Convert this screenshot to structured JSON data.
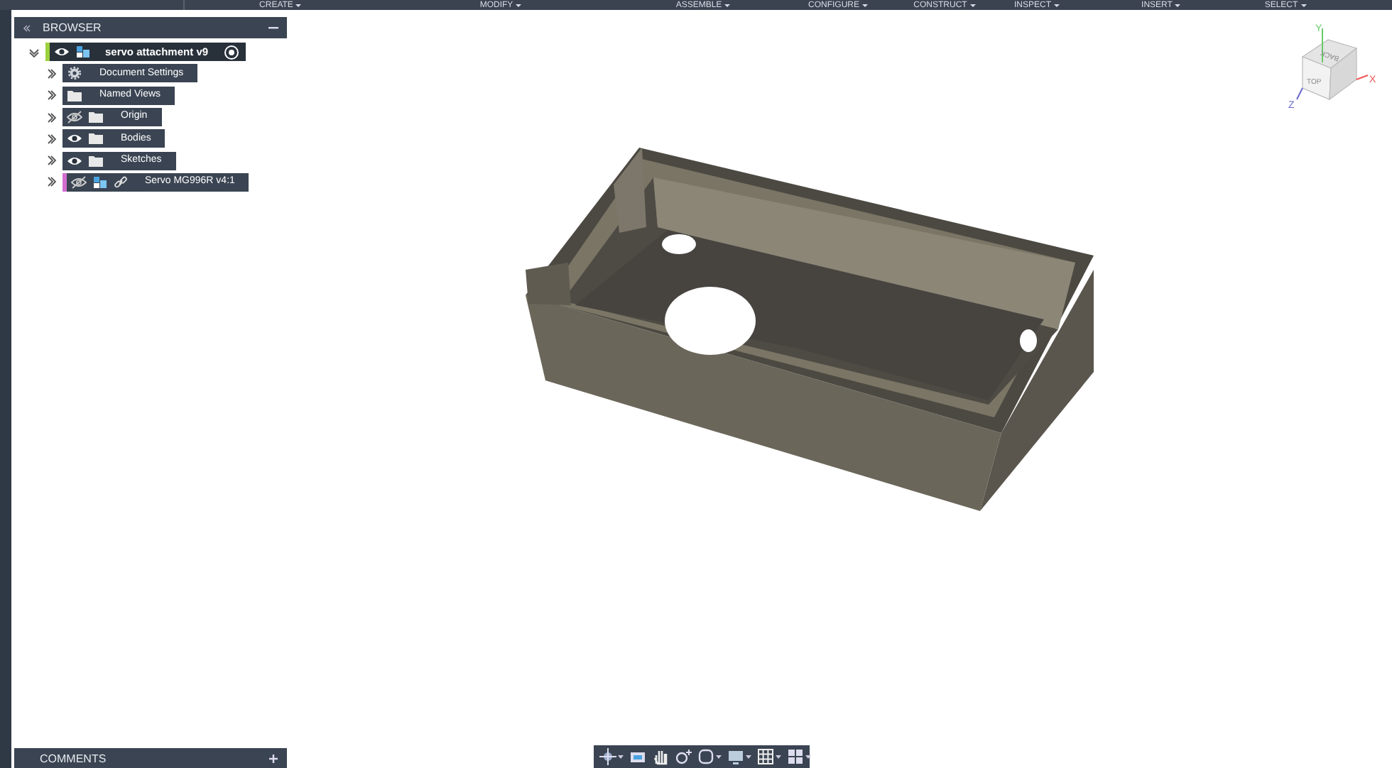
{
  "toolbar": {
    "menus": [
      {
        "label": "CREATE"
      },
      {
        "label": "MODIFY"
      },
      {
        "label": "ASSEMBLE"
      },
      {
        "label": "CONFIGURE"
      },
      {
        "label": "CONSTRUCT"
      },
      {
        "label": "INSPECT"
      },
      {
        "label": "INSERT"
      },
      {
        "label": "SELECT"
      }
    ]
  },
  "browser": {
    "title": "BROWSER",
    "root": {
      "label": "servo attachment v9",
      "expanded": true,
      "visible": true,
      "active": true,
      "color": "#9ad13c",
      "children": [
        {
          "label": "Document Settings",
          "kind": "gear",
          "expanded": false
        },
        {
          "label": "Named Views",
          "kind": "folder",
          "expanded": false
        },
        {
          "label": "Origin",
          "kind": "folder",
          "visible": false,
          "expanded": false
        },
        {
          "label": "Bodies",
          "kind": "folder",
          "visible": true,
          "expanded": false
        },
        {
          "label": "Sketches",
          "kind": "folder",
          "visible": true,
          "expanded": false
        },
        {
          "label": "Servo MG996R v4:1",
          "kind": "linked-component",
          "visible": false,
          "expanded": false,
          "color": "#d36fd0"
        }
      ]
    }
  },
  "viewcube": {
    "faces": [
      "BACK",
      "TOP"
    ],
    "axes": [
      "Y",
      "X",
      "Z"
    ]
  },
  "comments": {
    "title": "COMMENTS"
  }
}
